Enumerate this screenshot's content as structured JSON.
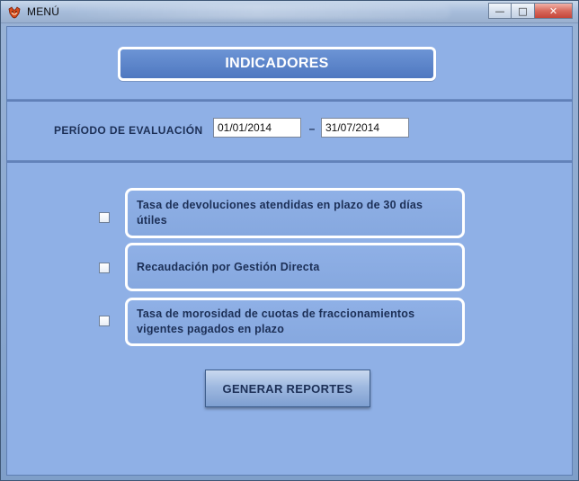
{
  "window": {
    "title": "MENÚ",
    "buttons": {
      "minimize": "—",
      "maximize": "□",
      "close": "✕"
    }
  },
  "header": {
    "title": "INDICADORES"
  },
  "period": {
    "label": "PERÍODO DE EVALUACIÓN",
    "start_value": "01/01/2014",
    "separator": "–",
    "end_value": "31/07/2014"
  },
  "indicators": [
    {
      "label": "Tasa de devoluciones atendidas  en plazo de 30  días útiles",
      "checked": false
    },
    {
      "label": "Recaudación  por  Gestión Directa",
      "checked": false
    },
    {
      "label": "Tasa de morosidad  de cuotas  de fraccionamientos vigentes pagados  en plazo",
      "checked": false
    }
  ],
  "actions": {
    "generate_label": "GENERAR REPORTES"
  },
  "colors": {
    "primary": "#4f78c0",
    "panel": "#8fb0e6",
    "text_dark": "#1c2f56",
    "close_button": "#c4463a"
  },
  "icons": {
    "app": "fox-icon"
  }
}
